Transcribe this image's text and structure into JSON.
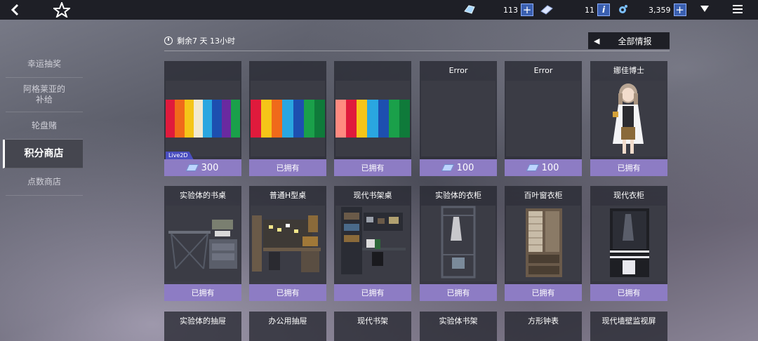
{
  "topbar": {
    "res1_value": "113",
    "res2_value": "11",
    "res3_value": "3,359"
  },
  "sidebar": {
    "items": [
      {
        "label": "幸运抽奖"
      },
      {
        "label": "阿格莱亚的补给"
      },
      {
        "label": "轮盘赌"
      },
      {
        "label": "积分商店"
      },
      {
        "label": "点数商店"
      }
    ],
    "active_index": 3
  },
  "shop": {
    "timer": "剩余7 天 13小时",
    "all_info_label": "全部情报",
    "row1": [
      {
        "title": "",
        "footer": "300",
        "badge": "Live2D"
      },
      {
        "title": "",
        "footer": "已拥有"
      },
      {
        "title": "",
        "footer": "已拥有"
      },
      {
        "title": "Error",
        "footer": "100"
      },
      {
        "title": "Error",
        "footer": "100"
      },
      {
        "title": "娜佳博士",
        "footer": "已拥有"
      }
    ],
    "row2": [
      {
        "title": "实验体的书桌",
        "footer": "已拥有"
      },
      {
        "title": "普通H型桌",
        "footer": "已拥有"
      },
      {
        "title": "现代书架桌",
        "footer": "已拥有"
      },
      {
        "title": "实验体的衣柜",
        "footer": "已拥有"
      },
      {
        "title": "百叶窗衣柜",
        "footer": "已拥有"
      },
      {
        "title": "现代衣柜",
        "footer": "已拥有"
      }
    ],
    "row3": [
      {
        "title": "实验体的抽屉"
      },
      {
        "title": "办公用抽屉"
      },
      {
        "title": "现代书架"
      },
      {
        "title": "实验体书架"
      },
      {
        "title": "方形钟表"
      },
      {
        "title": "现代墙壁监视屏"
      }
    ]
  },
  "colors": {
    "accent": "#8d7cc4",
    "plus_button": "#3a5fb0"
  }
}
